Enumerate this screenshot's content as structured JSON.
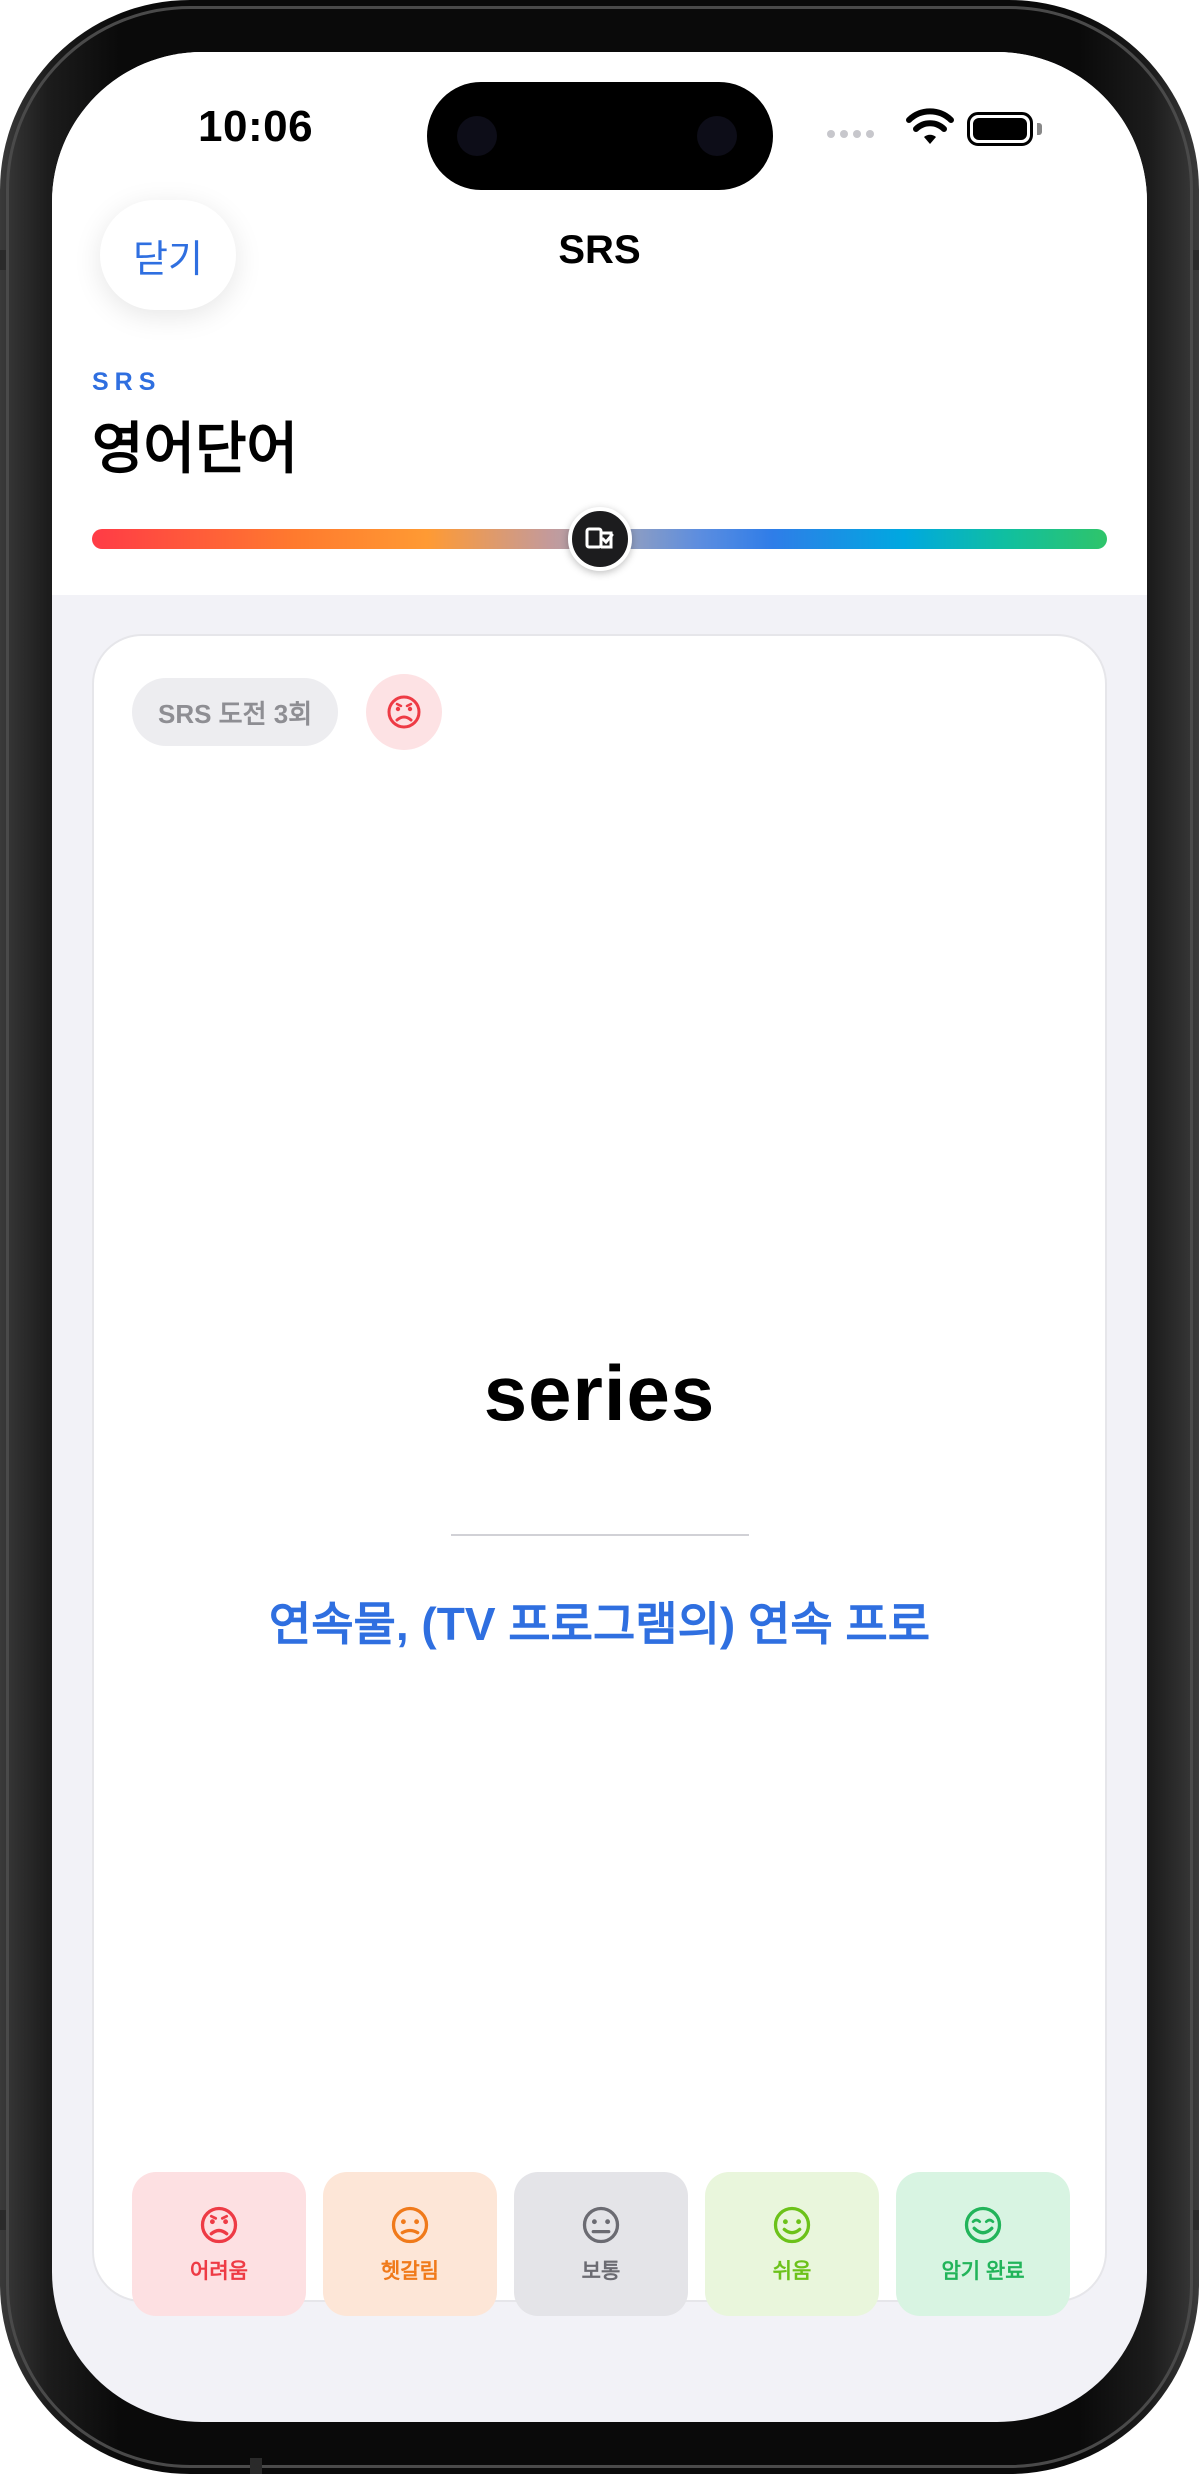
{
  "status_bar": {
    "time": "10:06"
  },
  "nav": {
    "close_label": "닫기",
    "title": "SRS"
  },
  "header": {
    "subtitle": "SRS",
    "deck_title": "영어단어"
  },
  "progress": {
    "thumb_position": 0.5
  },
  "card": {
    "badge_text": "SRS 도전 3회",
    "word": "series",
    "meaning": "연속물, (TV 프로그램의) 연속 프로"
  },
  "rating_buttons": [
    {
      "label": "어려움",
      "icon": "frown-icon",
      "color": "#ee3b45",
      "bg": "#fde0e2"
    },
    {
      "label": "헷갈림",
      "icon": "confused-icon",
      "color": "#f07a1a",
      "bg": "#fde6d7"
    },
    {
      "label": "보통",
      "icon": "neutral-icon",
      "color": "#6b6b72",
      "bg": "#e4e4e8"
    },
    {
      "label": "쉬움",
      "icon": "smile-icon",
      "color": "#6cc21a",
      "bg": "#e9f6dc"
    },
    {
      "label": "암기 완료",
      "icon": "grin-icon",
      "color": "#22b45a",
      "bg": "#d8f4e2"
    }
  ],
  "colors": {
    "accent": "#2f6fe0"
  }
}
